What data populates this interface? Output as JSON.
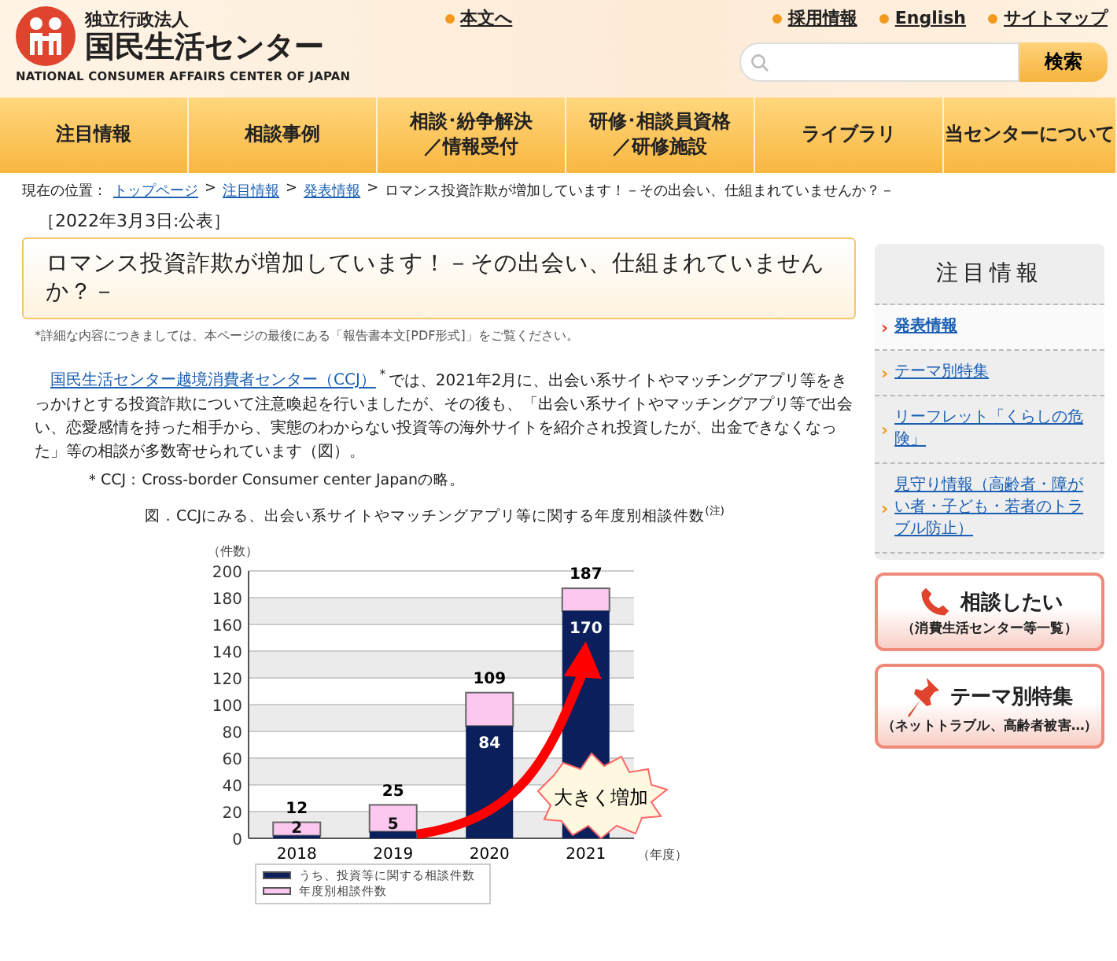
{
  "header": {
    "org_type": "独立行政法人",
    "org_name": "国民生活センター",
    "org_name_en": "NATIONAL CONSUMER AFFAIRS CENTER OF JAPAN",
    "skip_link": "本文へ",
    "top_links": [
      "採用情報",
      "English",
      "サイトマップ"
    ],
    "search": {
      "button": "検索"
    }
  },
  "nav": [
    {
      "label": "注目情報"
    },
    {
      "label": "相談事例"
    },
    {
      "label": "相談･紛争解決／情報受付"
    },
    {
      "label": "研修･相談員資格／研修施設"
    },
    {
      "label": "ライブラリ"
    },
    {
      "label": "当センターについて"
    }
  ],
  "breadcrumb": {
    "label": "現在の位置：",
    "separator": ">",
    "links": [
      "トップページ",
      "注目情報",
      "発表情報"
    ],
    "current": "ロマンス投資詐欺が増加しています！－その出会い、仕組まれていませんか？－"
  },
  "article": {
    "date": "［2022年3月3日:公表］",
    "title": "ロマンス投資詐欺が増加しています！－その出会い、仕組まれていませんか？－",
    "note": "*詳細な内容につきましては、本ページの最後にある「報告書本文[PDF形式]」をご覧ください。",
    "body_link": "国民生活センター越境消費者センター（CCJ）",
    "body": "$^{＊}$では、2021年2月に、出会い系サイトやマッチングアプリ等をきっかけとする投資詐欺について注意喚起を行いましたが、その後も、「出会い系サイトやマッチングアプリ等で出会い、恋愛感情を持った相手から、実態のわからない投資等の海外サイトを紹介され投資したが、出金できなくなった」等の相談が多数寄せられています（図）。",
    "footnote": "＊CCJ：Cross-border Consumer center Japanの略。",
    "figure": {
      "caption": "図．CCJにみる、出会い系サイトやマッチングアプリ等に関する年度別相談件数",
      "caption_mark": "(注)",
      "chart_data": {
        "type": "bar",
        "ylabel": "（件数）",
        "xlabel": "（年度）",
        "categories": [
          "2018",
          "2019",
          "2020",
          "2021"
        ],
        "series": [
          {
            "name": "うち、投資等に関する相談件数",
            "color": "#0a1f5c",
            "values": [
              2,
              5,
              84,
              170
            ],
            "value_labels": [
              "2",
              "5",
              "84",
              "170"
            ]
          },
          {
            "name": "年度別相談件数",
            "color": "#fcc8f0",
            "values": [
              10,
              20,
              25,
              17
            ]
          }
        ],
        "totals": [
          "12",
          "25",
          "109",
          "187"
        ],
        "ylim": [
          0,
          200
        ],
        "yticks": [
          0,
          20,
          40,
          60,
          80,
          100,
          120,
          140,
          160,
          180,
          200
        ],
        "stacked": true,
        "grid": true,
        "annotations": [
          "大きく増加"
        ]
      }
    }
  },
  "sidebar": {
    "title": "注目情報",
    "bullet": "›",
    "items": [
      {
        "label": "発表情報",
        "selected": true
      },
      {
        "label": "テーマ別特集",
        "selected": false
      },
      {
        "label": "リーフレット「くらしの危険」",
        "selected": false
      },
      {
        "label": "見守り情報（高齢者・障がい者・子ども・若者のトラブル防止）",
        "selected": false
      }
    ],
    "banners": [
      {
        "kind": "phone",
        "title": "相談したい",
        "subtitle": "（消費生活センター等一覧）"
      },
      {
        "kind": "pin",
        "title": "テーマ別特集",
        "subtitle": "（ネットトラブル、高齢者被害…）"
      }
    ]
  }
}
